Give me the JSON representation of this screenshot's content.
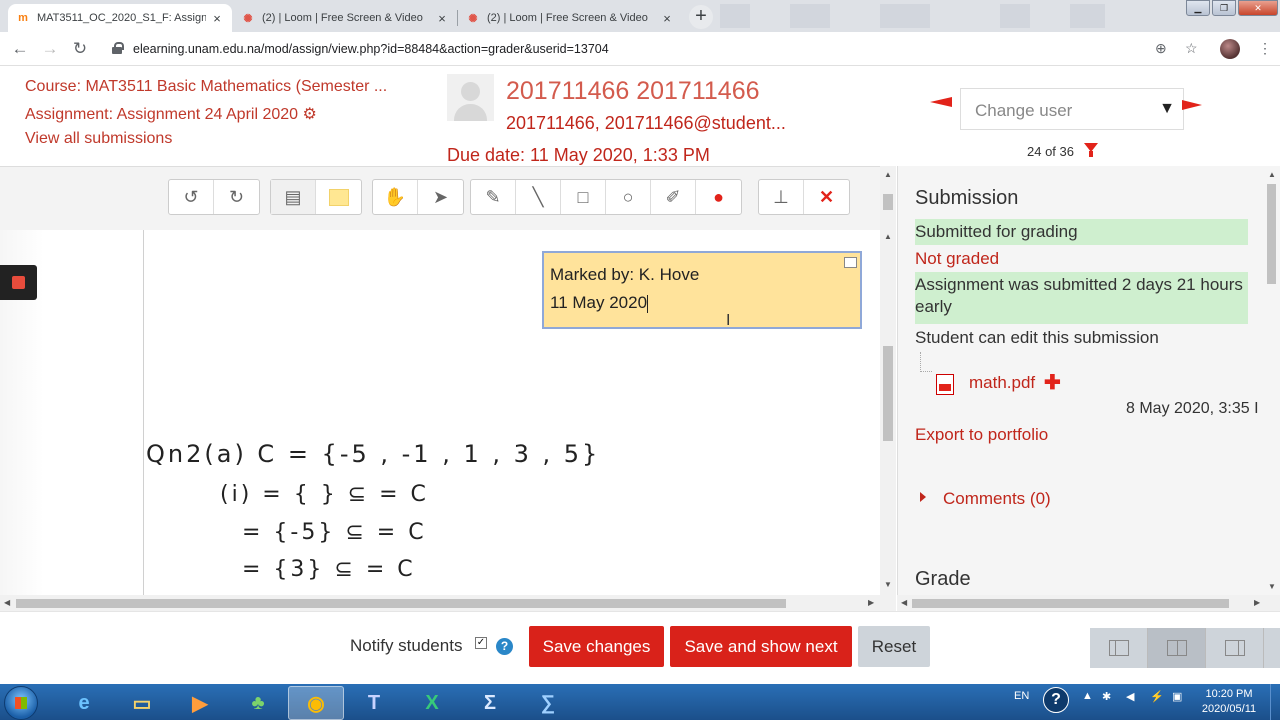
{
  "browser": {
    "tabs": [
      {
        "title": "MAT3511_OC_2020_S1_F: Assignment",
        "favicon": "moodle-icon",
        "close": "×"
      },
      {
        "title": "(2) | Loom | Free Screen & Video",
        "favicon": "loom-icon",
        "close": "×"
      },
      {
        "title": "(2) | Loom | Free Screen & Video",
        "favicon": "loom-icon",
        "close": "×"
      }
    ],
    "new_tab": "+",
    "url": "elearning.unam.edu.na/mod/assign/view.php?id=88484&action=grader&userid=13704"
  },
  "header": {
    "course": "Course: MAT3511 Basic Mathematics (Semester ...",
    "assignment": "Assignment: Assignment 24 April 2020",
    "view_all": "View all submissions",
    "user_name": "201711466 201711466",
    "user_email": "201711466, 201711466@student...",
    "due_date": "Due date: 11 May 2020, 1:33 PM",
    "change_user_placeholder": "Change user",
    "counter": "24 of 36"
  },
  "editor": {
    "tools": [
      [
        "rotate-left-icon",
        "rotate-right-icon"
      ],
      [
        "comment-icon",
        "comment-color-icon"
      ],
      [
        "pan-hand-icon",
        "select-pointer-icon"
      ],
      [
        "pen-icon",
        "line-icon",
        "rectangle-icon",
        "oval-icon",
        "highlight-icon",
        "annotation-color-icon"
      ],
      [
        "stamp-icon",
        "delete-icon"
      ]
    ],
    "comment": {
      "line1": "Marked by: K. Hove",
      "line2": "11 May 2020"
    },
    "handwriting": [
      "Qn2(a) C = {-5 , -1 , 1 , 3 , 5}",
      "(i) = { } ⊆ = C",
      "= {-5} ⊆ = C",
      "= {3} ⊆ = C"
    ]
  },
  "panel": {
    "title": "Submission",
    "status_submitted": "Submitted for grading",
    "status_grading": "Not graded",
    "status_early": "Assignment was submitted 2 days 21 hours early",
    "status_edit": "Student can edit this submission",
    "file_name": "math.pdf",
    "file_date": "8 May 2020, 3:35 I",
    "export": "Export to portfolio",
    "comments": "Comments (0)",
    "grade_title": "Grade"
  },
  "footer": {
    "notify_label": "Notify students",
    "save_changes": "Save changes",
    "save_next": "Save and show next",
    "reset": "Reset"
  },
  "taskbar": {
    "lang": "EN",
    "time": "10:20 PM",
    "date": "2020/05/11"
  },
  "colors": {
    "accent": "#d9221a",
    "link": "#c0261b",
    "success_bg": "#cfefcf",
    "comment_bg": "#ffe39b"
  }
}
